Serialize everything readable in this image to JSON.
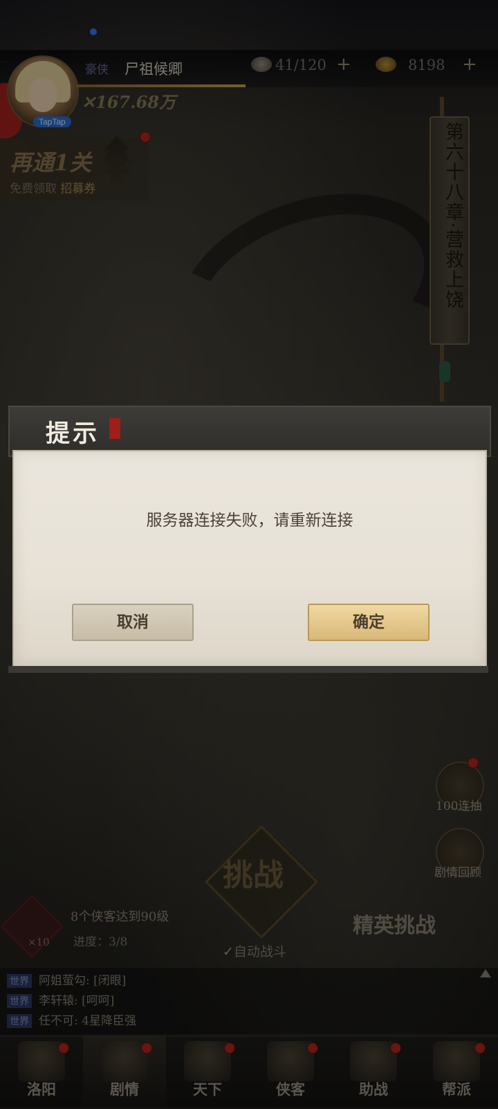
{
  "status_bar": {
    "dots": "..."
  },
  "player": {
    "vip_label": "豪侠",
    "name": "尸祖候卿",
    "power": "✕167.68万",
    "avatar_badge": "TapTap",
    "exp_progress": 1.0
  },
  "resources": [
    {
      "icon": "food-bun-icon",
      "value": "41/120",
      "plus": "+"
    },
    {
      "icon": "gold-ingot-icon",
      "value": "8198",
      "plus": "+"
    }
  ],
  "quest_banner": {
    "title": "再通1关",
    "subtitle_prefix": "免费领取 ",
    "subtitle_highlight": "招募券"
  },
  "chapter": {
    "title": "第六十八章·营救上饶"
  },
  "dialog": {
    "title": "提示",
    "message": "服务器连接失败，请重新连接",
    "cancel_label": "取消",
    "confirm_label": "确定"
  },
  "side_buttons": [
    {
      "icon": "scroll-draw-icon",
      "label": "100连抽"
    },
    {
      "icon": "book-replay-icon",
      "label": "剧情回顾"
    }
  ],
  "battle": {
    "challenge_label": "挑战",
    "elite_label": "精英挑战",
    "auto_check": "✓",
    "auto_label": "自动战斗"
  },
  "task": {
    "multiplier": "×10",
    "title": "8个侠客达到90级",
    "progress_text": "进度：3/8",
    "progress": {
      "current": 3,
      "total": 8
    }
  },
  "chat": [
    {
      "channel": "世界",
      "text": "阿姐萤勾: [闭眼]"
    },
    {
      "channel": "世界",
      "text": "李轩辕: [呵呵]"
    },
    {
      "channel": "世界",
      "text": "任不可: 4星降臣强"
    }
  ],
  "nav": [
    {
      "label": "洛阳",
      "icon": "city-gate-icon"
    },
    {
      "label": "剧情",
      "icon": "story-scroll-icon"
    },
    {
      "label": "天下",
      "icon": "world-sword-icon"
    },
    {
      "label": "侠客",
      "icon": "hero-hat-icon"
    },
    {
      "label": "助战",
      "icon": "assist-drum-icon"
    },
    {
      "label": "帮派",
      "icon": "guild-banner-icon"
    }
  ],
  "colors": {
    "accent_gold": "#c9a45a",
    "badge_red": "#b3261e",
    "chat_tag": "#2d3a63"
  }
}
